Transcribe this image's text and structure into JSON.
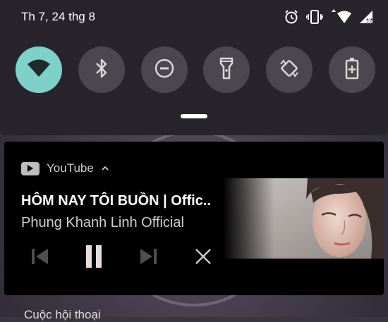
{
  "status_bar": {
    "date": "Th 7, 24 thg 8",
    "icons": [
      "alarm-icon",
      "vibrate-icon",
      "wifi-icon",
      "cell-signal-icon"
    ]
  },
  "quick_settings": {
    "tiles": [
      {
        "name": "wifi",
        "icon": "wifi-icon",
        "active": true
      },
      {
        "name": "bluetooth",
        "icon": "bluetooth-icon",
        "active": false
      },
      {
        "name": "do-not-disturb",
        "icon": "do-not-disturb-icon",
        "active": false
      },
      {
        "name": "flashlight",
        "icon": "flashlight-icon",
        "active": false
      },
      {
        "name": "auto-rotate",
        "icon": "auto-rotate-icon",
        "active": false
      },
      {
        "name": "battery-saver",
        "icon": "battery-saver-icon",
        "active": false
      }
    ],
    "active_color": "#7ed1c8",
    "inactive_color": "#4a484e"
  },
  "notification": {
    "app_name": "YouTube",
    "title": "HÔM NAY TÔI BUỒN | Offic..",
    "artist": "Phung Khanh Linh Official",
    "controls": [
      "previous-icon",
      "pause-icon",
      "next-icon",
      "close-icon"
    ],
    "state": "playing"
  },
  "background_peek_text": "Cuộc hội thoại"
}
